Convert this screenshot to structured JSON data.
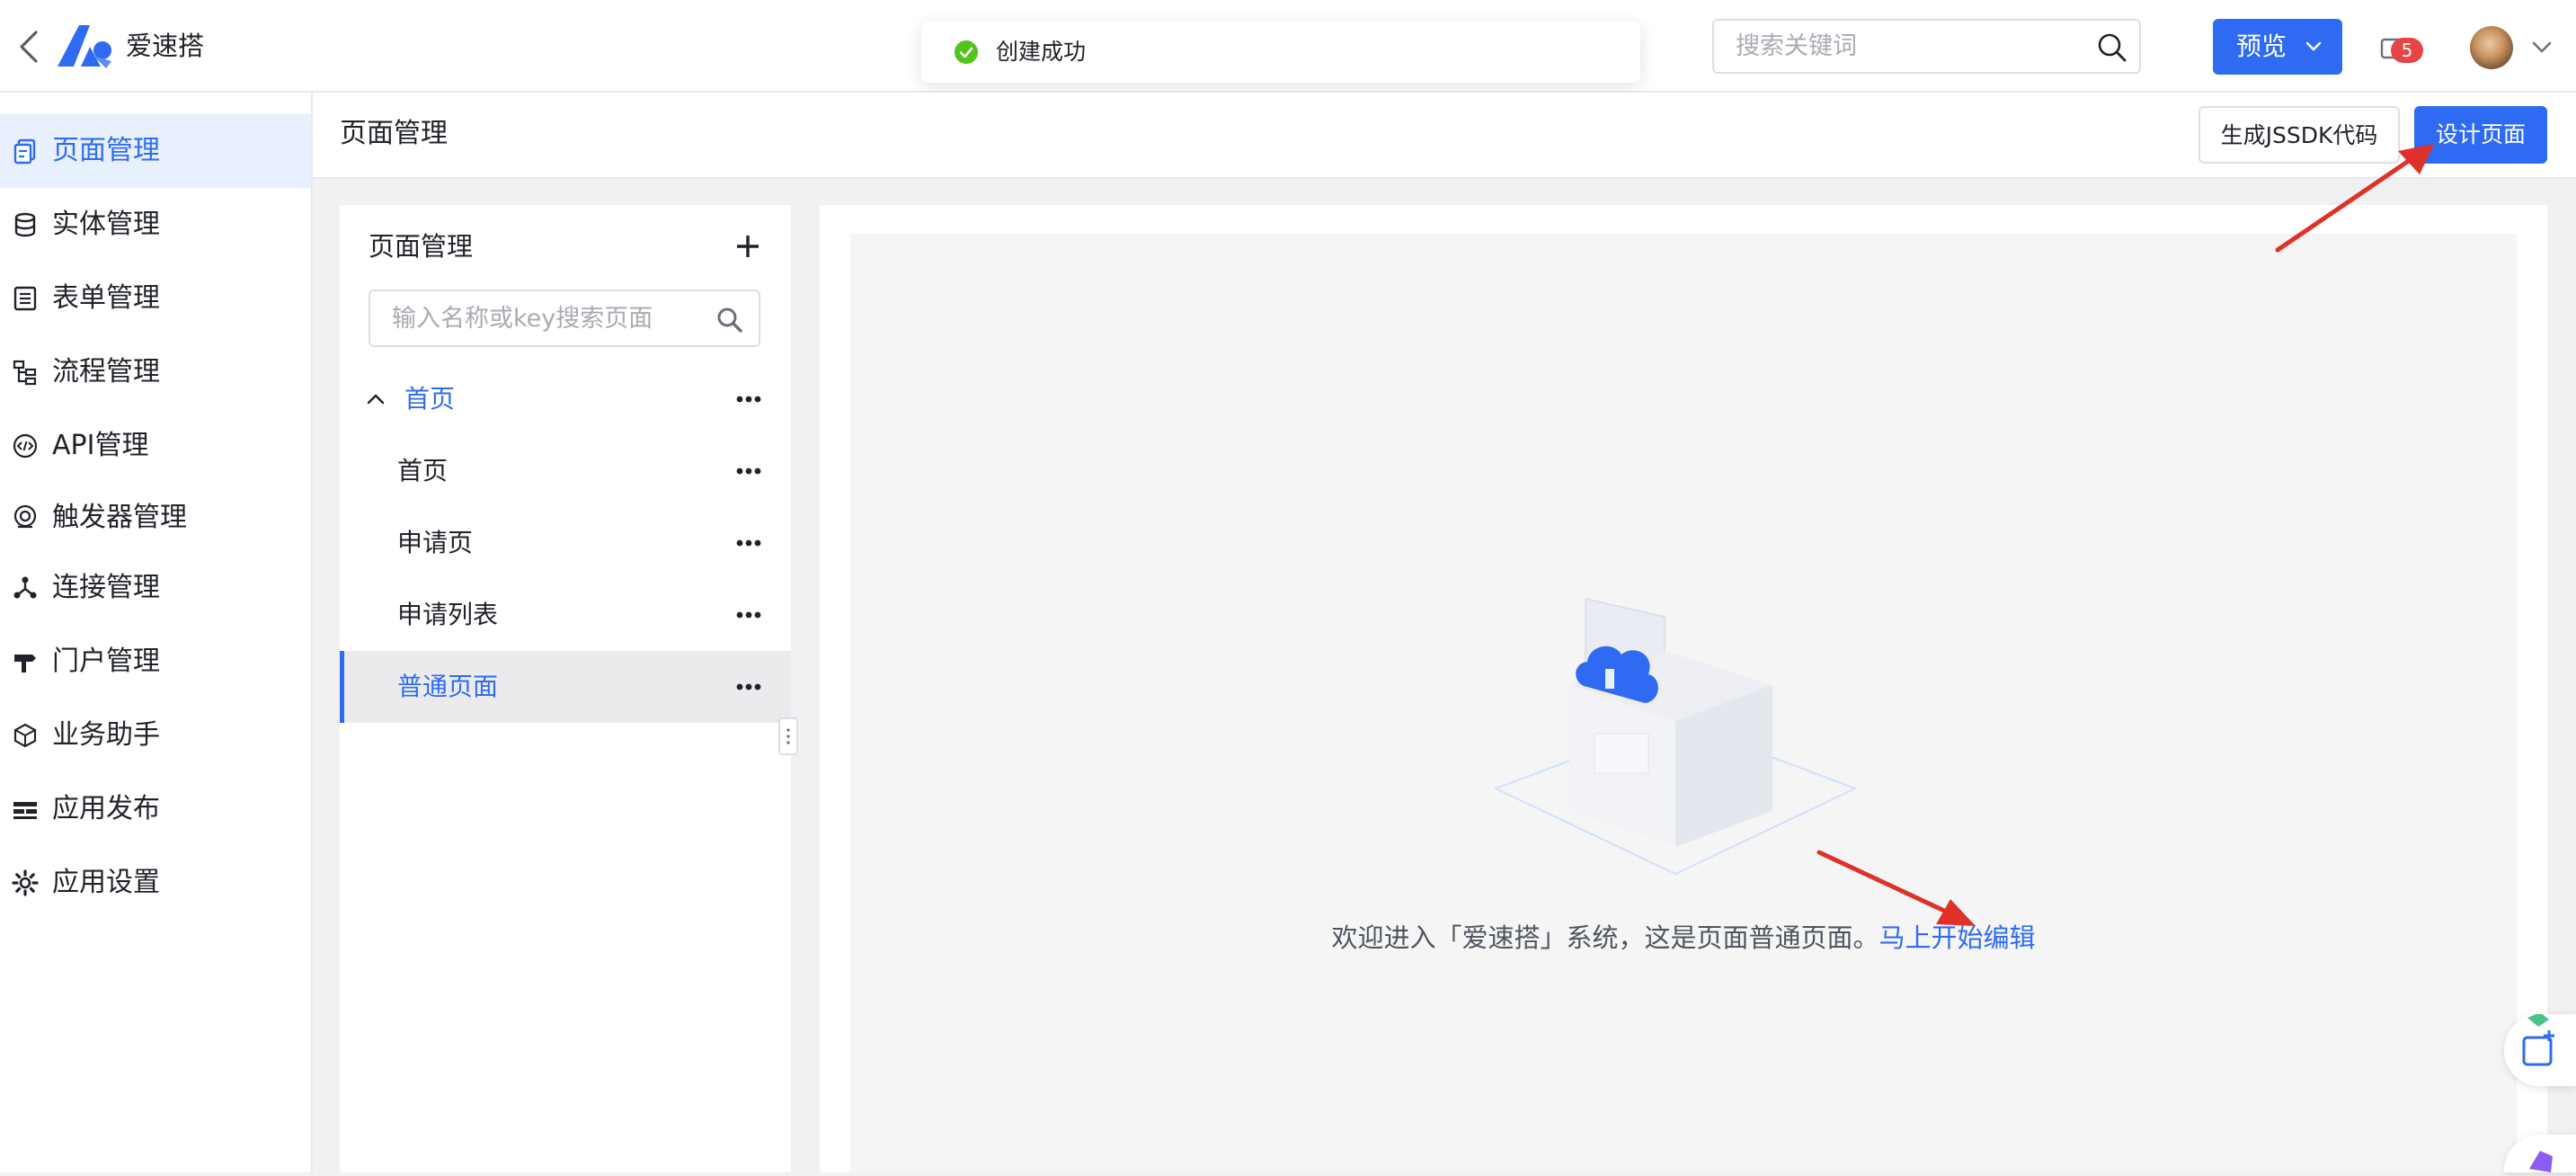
{
  "app": {
    "name": "爱速搭"
  },
  "toast": {
    "message": "创建成功"
  },
  "search": {
    "placeholder": "搜索关键词"
  },
  "header": {
    "preview_label": "预览",
    "notification_count": "5"
  },
  "nav": {
    "items": [
      {
        "label": "页面管理",
        "icon": "pages-icon",
        "active": true
      },
      {
        "label": "实体管理",
        "icon": "database-icon"
      },
      {
        "label": "表单管理",
        "icon": "form-icon"
      },
      {
        "label": "流程管理",
        "icon": "workflow-icon"
      },
      {
        "label": "API管理",
        "icon": "api-icon"
      },
      {
        "label": "触发器管理",
        "icon": "trigger-icon"
      },
      {
        "label": "连接管理",
        "icon": "connection-icon"
      },
      {
        "label": "门户管理",
        "icon": "portal-icon"
      },
      {
        "label": "业务助手",
        "icon": "assistant-icon"
      },
      {
        "label": "应用发布",
        "icon": "publish-icon"
      },
      {
        "label": "应用设置",
        "icon": "settings-icon"
      }
    ]
  },
  "page": {
    "title": "页面管理",
    "jssdk_label": "生成JSSDK代码",
    "design_label": "设计页面"
  },
  "tree": {
    "title": "页面管理",
    "search_placeholder": "输入名称或key搜索页面",
    "group": {
      "label": "首页"
    },
    "children": [
      {
        "label": "首页"
      },
      {
        "label": "申请页"
      },
      {
        "label": "申请列表"
      },
      {
        "label": "普通页面",
        "selected": true
      }
    ]
  },
  "content": {
    "welcome_text": "欢迎进入「爱速搭」系统，这是页面普通页面。",
    "welcome_link": "马上开始编辑"
  },
  "colors": {
    "accent": "#2f6bf2",
    "success": "#52c41a",
    "annotation_arrow": "#e0302a",
    "badge": "#e64545"
  }
}
